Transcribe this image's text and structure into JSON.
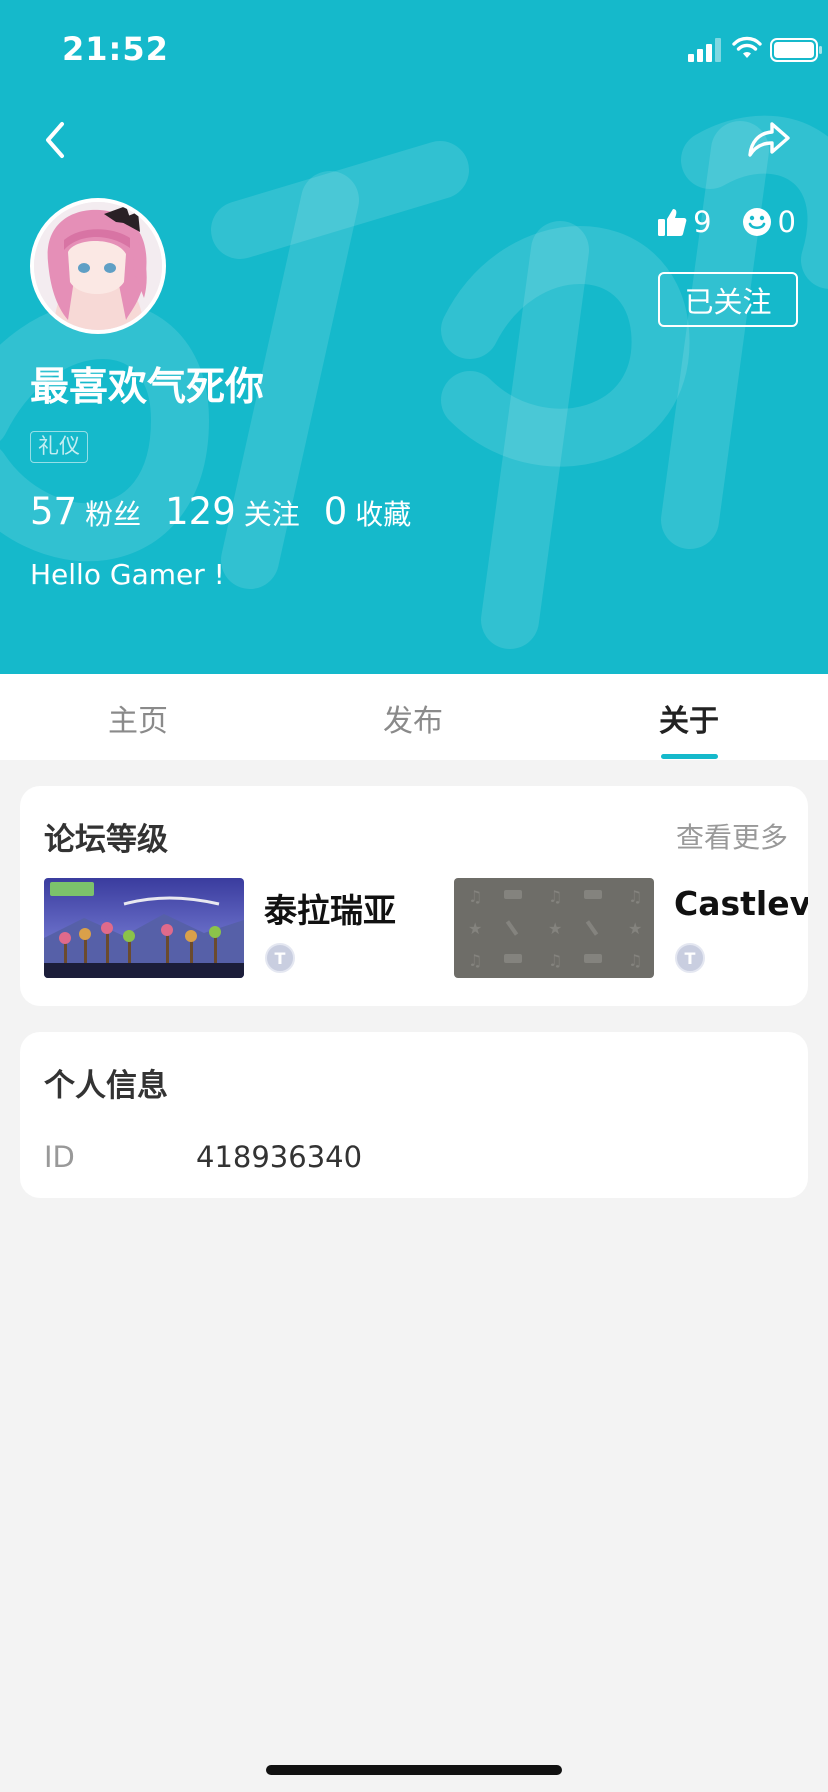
{
  "status_bar": {
    "time": "21:52"
  },
  "header": {
    "likes": "9",
    "smiles": "0",
    "follow_label": "已关注",
    "username": "最喜欢气死你",
    "role_badge": "礼仪",
    "fans_count": "57",
    "fans_label": "粉丝",
    "following_count": "129",
    "following_label": "关注",
    "favorites_count": "0",
    "favorites_label": "收藏",
    "bio": "Hello Gamer !",
    "accent_color": "#15b9cb"
  },
  "tabs": [
    {
      "label": "主页"
    },
    {
      "label": "发布"
    },
    {
      "label": "关于",
      "active": true
    }
  ],
  "forum_level": {
    "title": "论坛等级",
    "more_label": "查看更多",
    "games": [
      {
        "name": "泰拉瑞亚",
        "level_icon": "level-badge-icon"
      },
      {
        "name": "Castleva",
        "level_icon": "level-badge-icon"
      }
    ]
  },
  "personal_info": {
    "title": "个人信息",
    "rows": [
      {
        "key": "ID",
        "value": "418936340"
      }
    ]
  }
}
